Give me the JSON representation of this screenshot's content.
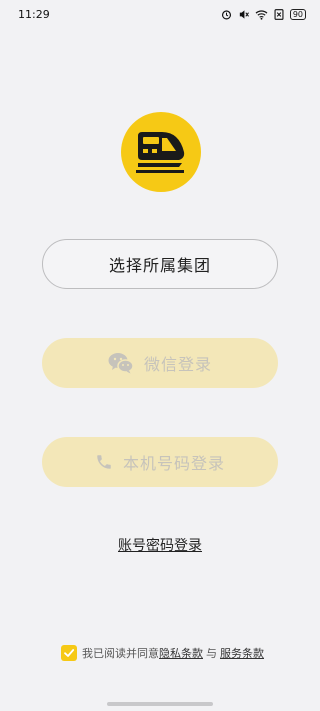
{
  "status_bar": {
    "time": "11:29",
    "icons": [
      "alarm-icon",
      "mute-icon",
      "wifi-icon",
      "sim-icon",
      "battery-icon"
    ],
    "battery": "90"
  },
  "logo": {
    "icon": "train-icon",
    "color": "#f6c915"
  },
  "buttons": {
    "select_group": "选择所属集团",
    "wechat_login": "微信登录",
    "phone_login": "本机号码登录"
  },
  "account_login": "账号密码登录",
  "agreement": {
    "prefix": "我已阅读并同意",
    "privacy": "隐私条款",
    "and": "与",
    "service": "服务条款",
    "checked": true
  },
  "colors": {
    "accent": "#f6c915",
    "disabled_button": "#f3e7b8",
    "background": "#f2f2f4"
  }
}
